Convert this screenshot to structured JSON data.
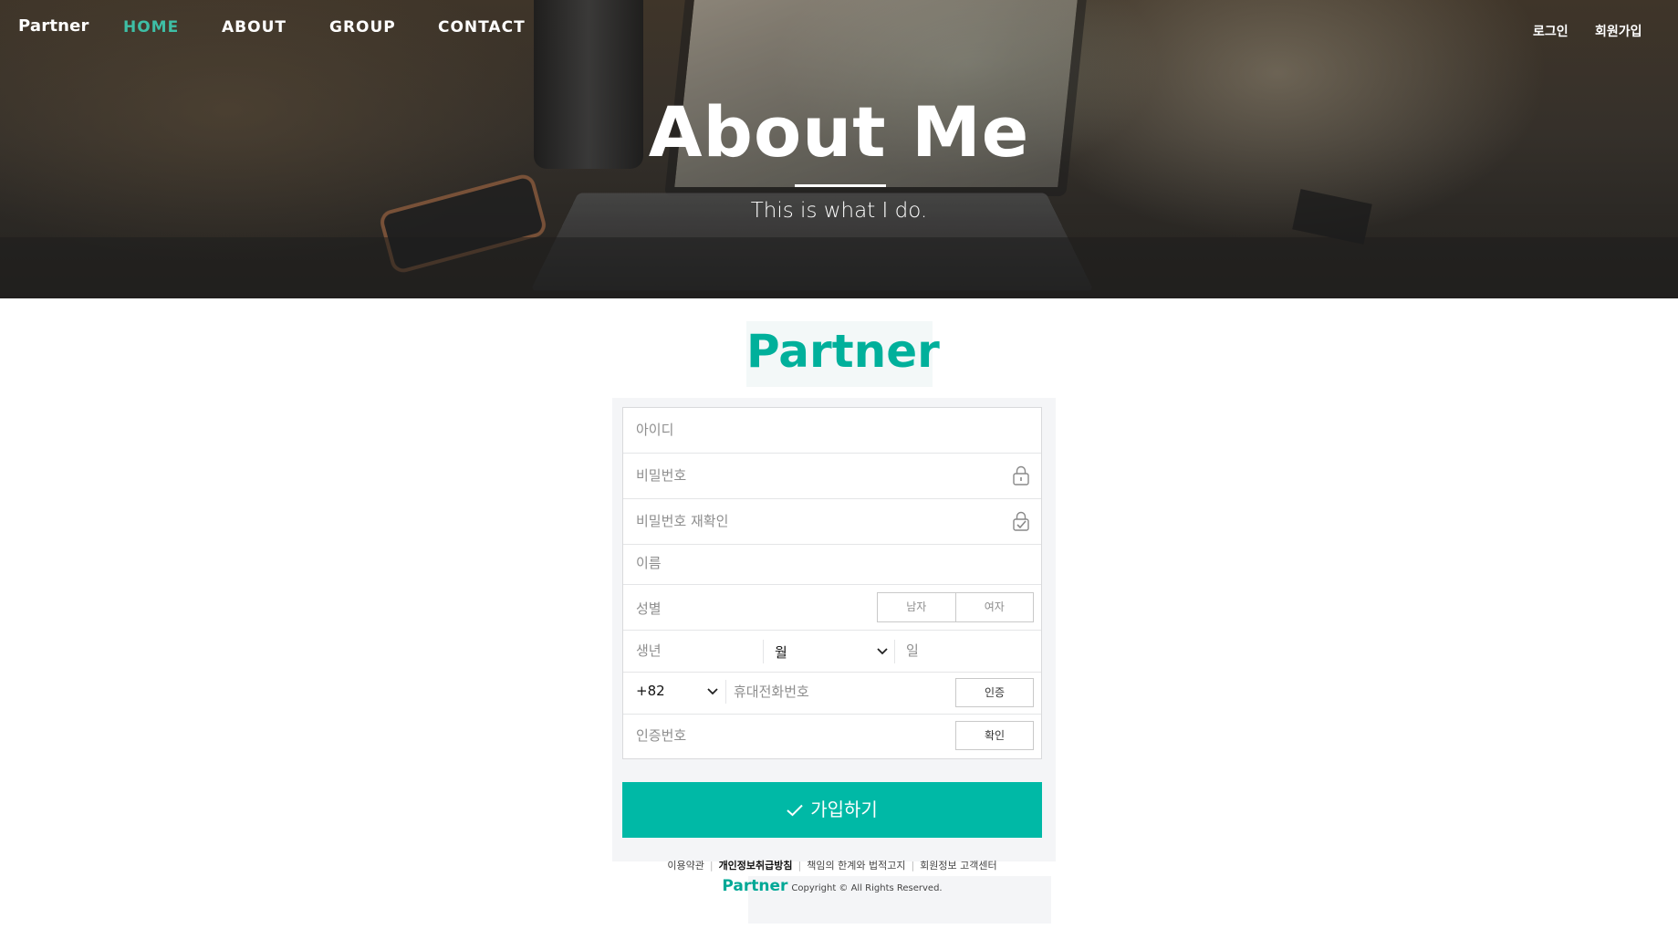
{
  "nav": {
    "brand": "Partner",
    "links": [
      "HOME",
      "ABOUT",
      "GROUP",
      "CONTACT"
    ],
    "active": "HOME",
    "login": "로그인",
    "signup": "회원가입"
  },
  "hero": {
    "title": "About Me",
    "subtitle": "This is what I do."
  },
  "form": {
    "logo": "Partner",
    "id_placeholder": "아이디",
    "password_placeholder": "비밀번호",
    "password_confirm_placeholder": "비밀번호 재확인",
    "name_placeholder": "이름",
    "gender_label": "성별",
    "gender_options": [
      "남자",
      "여자"
    ],
    "birth_year_placeholder": "생년",
    "birth_month_value": "월",
    "birth_day_placeholder": "일",
    "country_code": "+82",
    "phone_placeholder": "휴대전화번호",
    "verify_button": "인증",
    "code_placeholder": "인증번호",
    "confirm_button": "확인",
    "submit_label": "가입하기"
  },
  "footer": {
    "links": [
      "이용약관",
      "개인정보취급방침",
      "책임의 한계와 법적고지",
      "회원정보 고객센터"
    ],
    "brand": "Partner",
    "copyright": "Copyright  ©  All Rights Reserved."
  },
  "colors": {
    "accent": "#00b9a6",
    "nav_active": "#3ebfa6"
  },
  "icons": {
    "password": "lock-icon",
    "password_confirm": "lock-check-icon",
    "select": "chevron-down-icon",
    "submit": "check-icon"
  }
}
